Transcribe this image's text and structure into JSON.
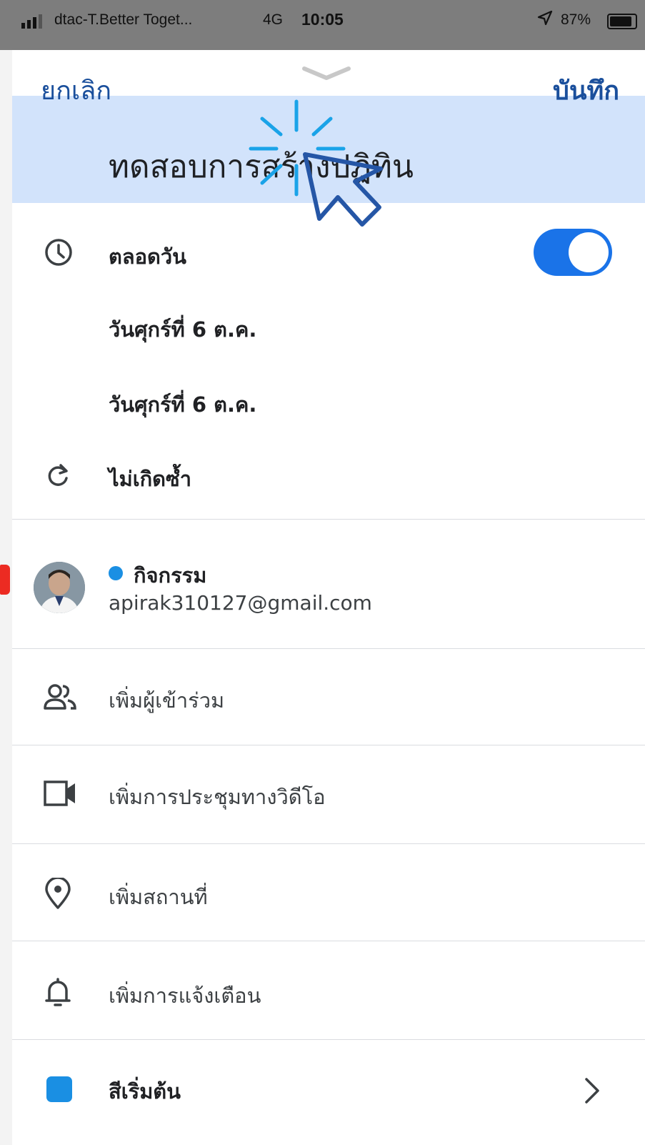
{
  "status_bar": {
    "carrier": "dtac-T.Better Toget...",
    "network": "4G",
    "time": "10:05",
    "battery": "87%"
  },
  "header": {
    "cancel_label": "ยกเลิก",
    "save_label": "บันทึก",
    "event_title": "ทดสอบการสร้างปฏิทิน"
  },
  "all_day": {
    "label": "ตลอดวัน",
    "enabled": true
  },
  "dates": {
    "start": "วันศุกร์ที่ 6 ต.ค.",
    "end": "วันศุกร์ที่ 6 ต.ค."
  },
  "repeat": {
    "label": "ไม่เกิดซ้ำ"
  },
  "calendar": {
    "name": "กิจกรรม",
    "account": "apirak310127@gmail.com",
    "dot_color": "#1a8fe3"
  },
  "options": {
    "add_guests": "เพิ่มผู้เข้าร่วม",
    "add_video": "เพิ่มการประชุมทางวิดีโอ",
    "add_location": "เพิ่มสถานที่",
    "add_notification": "เพิ่มการแจ้งเตือน",
    "default_color": "สีเริ่มต้น"
  },
  "colors": {
    "accent": "#1a73e8",
    "title_band": "#d2e3fb",
    "header_text": "#1a4f9c",
    "status_bar": "#7d7d7d"
  }
}
